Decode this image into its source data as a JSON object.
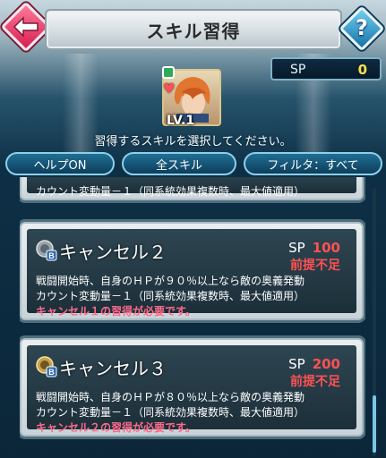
{
  "header": {
    "title": "スキル習得",
    "back_icon": "back-arrow-icon",
    "help_icon": "question-icon",
    "help_label": "?"
  },
  "sp": {
    "label": "SP",
    "value": "0"
  },
  "hero": {
    "level": "LV.1"
  },
  "instruction": "習得するスキルを選択してください。",
  "tabs": [
    {
      "label": "ヘルプON"
    },
    {
      "label": "全スキル"
    },
    {
      "label": "フィルタ：すべて"
    }
  ],
  "skills": [
    {
      "desc_line2": "カウント変動量－１（同系統効果複数時、最大値適用）"
    },
    {
      "name": "キャンセル２",
      "sp_label": "SP",
      "sp_cost": "100",
      "status": "前提不足",
      "desc_line1": "戦闘開始時、自身のＨＰが９０％以上なら敵の奥義発動",
      "desc_line2": "カウント変動量－１（同系統効果複数時、最大値適用）",
      "requirement": "キャンセル１の習得が必要です。"
    },
    {
      "name": "キャンセル３",
      "sp_label": "SP",
      "sp_cost": "200",
      "status": "前提不足",
      "desc_line1": "戦闘開始時、自身のＨＰが８０％以上なら敵の奥義発動",
      "desc_line2": "カウント変動量－１（同系統効果複数時、最大値適用）",
      "requirement": "キャンセル２の習得が必要です。"
    }
  ],
  "colors": {
    "accent": "#8cd0ea",
    "sp_value": "#ffe14d",
    "warning": "#ff5252"
  }
}
